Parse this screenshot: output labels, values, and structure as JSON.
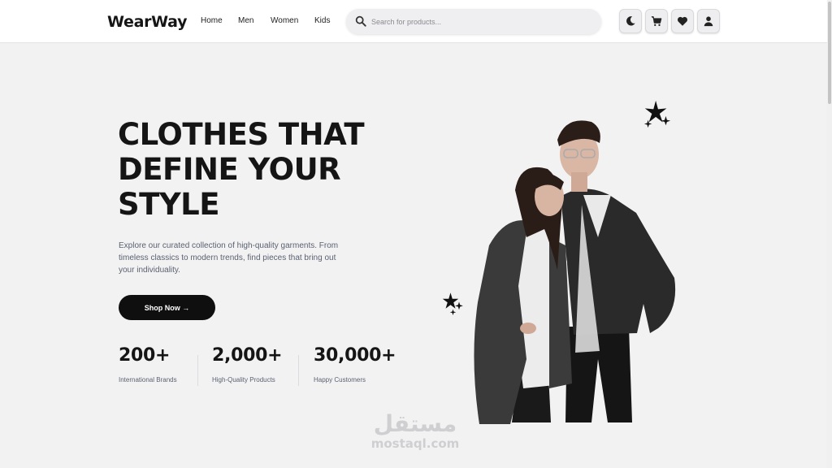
{
  "header": {
    "logo": "WearWay",
    "nav": [
      {
        "label": "Home"
      },
      {
        "label": "Men"
      },
      {
        "label": "Women"
      },
      {
        "label": "Kids"
      }
    ],
    "search": {
      "placeholder": "Search for products..."
    },
    "icons": [
      "moon-icon",
      "cart-icon",
      "heart-icon",
      "user-icon"
    ]
  },
  "hero": {
    "title_lines": [
      "CLOTHES THAT",
      "DEFINE YOUR",
      "STYLE"
    ],
    "description": "Explore our curated collection of high-quality garments. From timeless classics to modern trends, find pieces that bring out your individuality.",
    "cta_label": "Shop Now →",
    "stats": [
      {
        "value": "200+",
        "label": "International Brands"
      },
      {
        "value": "2,000+",
        "label": "High-Quality Products"
      },
      {
        "value": "30,000+",
        "label": "Happy Customers"
      }
    ]
  },
  "watermark": {
    "arabic": "مستقل",
    "latin": "mostaql.com"
  },
  "colors": {
    "accent": "#0f0f10",
    "background": "#f2f2f3",
    "muted_text": "#5b6170"
  }
}
